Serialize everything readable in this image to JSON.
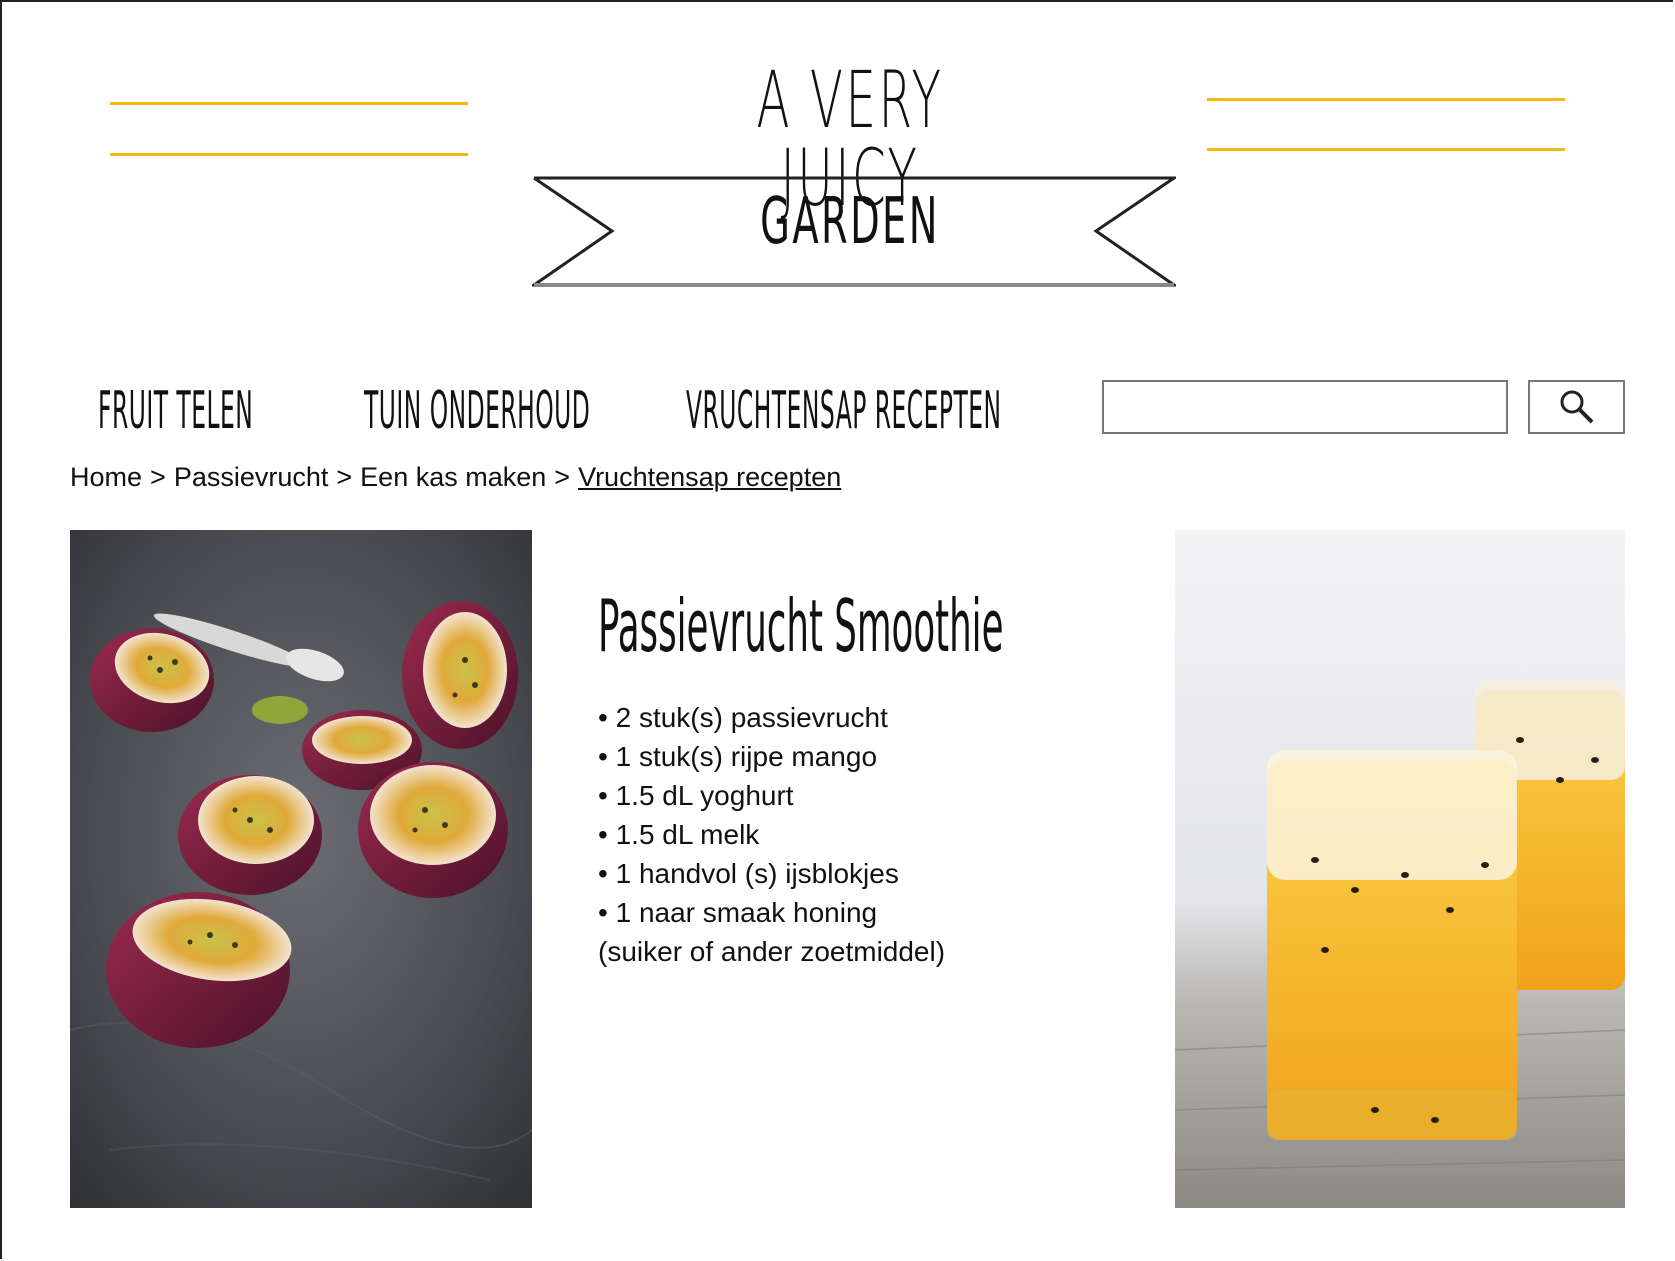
{
  "logo": {
    "line1": "A VERY JUICY",
    "line2": "GARDEN",
    "accent_color": "#f5b914"
  },
  "nav": {
    "items": [
      {
        "label": "FRUIT TELEN"
      },
      {
        "label": "TUIN ONDERHOUD"
      },
      {
        "label": "VRUCHTENSAP RECEPTEN"
      }
    ]
  },
  "search": {
    "value": "",
    "button_icon": "search-icon"
  },
  "breadcrumb": {
    "items": [
      "Home",
      "Passievrucht",
      "Een kas maken",
      "Vruchtensap recepten"
    ],
    "separator": ">"
  },
  "recipe": {
    "title": "Passievrucht Smoothie",
    "ingredients": [
      "2 stuk(s) passievrucht",
      "1 stuk(s) rijpe mango",
      "1.5 dL yoghurt",
      "1.5 dL melk",
      "1 handvol (s) ijsblokjes",
      "1 naar smaak honing"
    ],
    "note": "(suiker of ander zoetmiddel)"
  }
}
